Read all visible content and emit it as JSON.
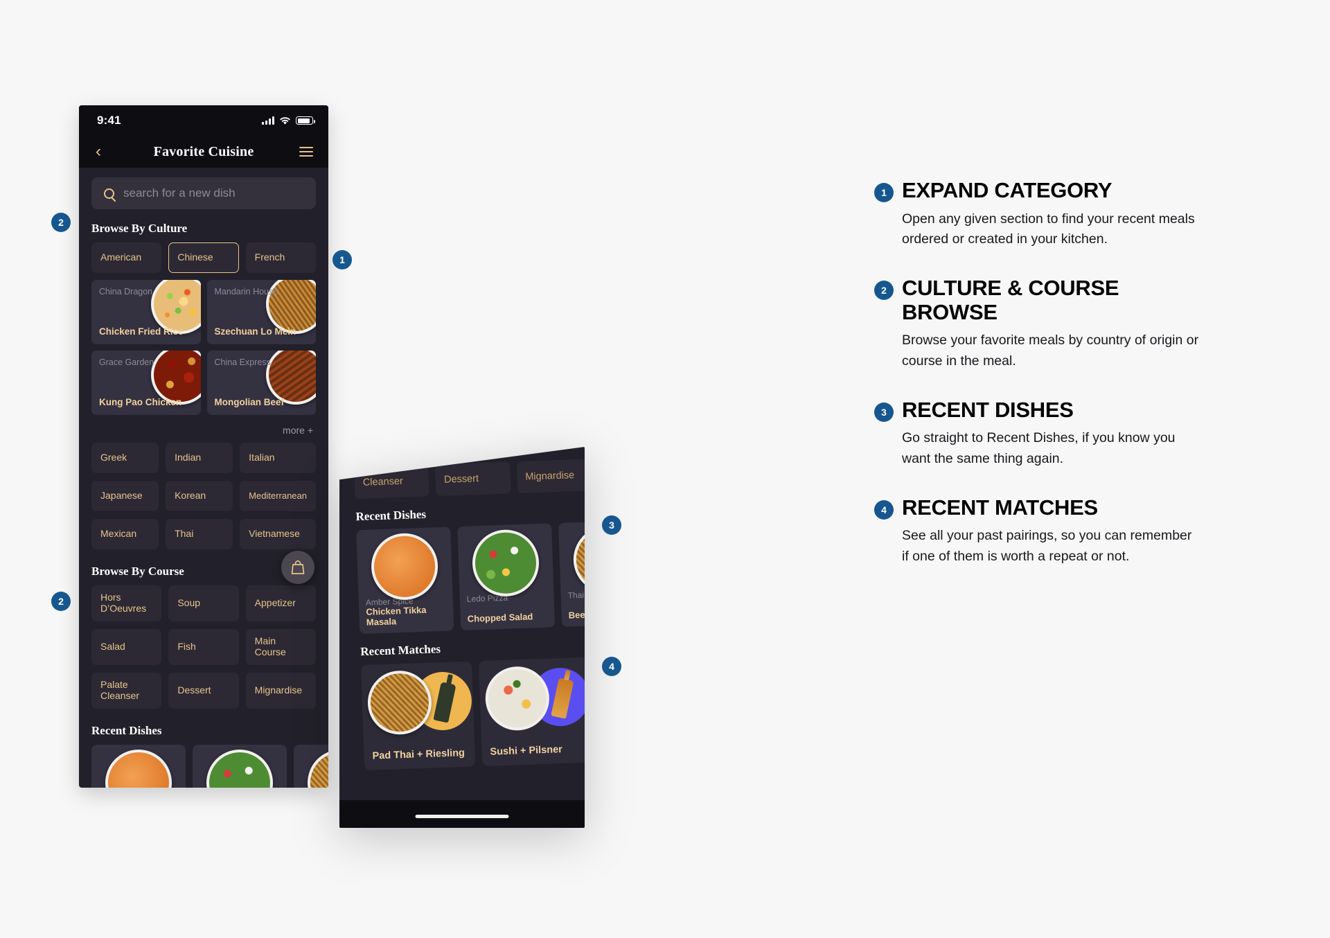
{
  "phone_main": {
    "status_bar": {
      "time": "9:41",
      "signal_icon": "cellular-bars-icon",
      "wifi_icon": "wifi-icon",
      "battery_icon": "battery-icon"
    },
    "nav": {
      "back_icon": "chevron-left-icon",
      "title": "Favorite Cuisine",
      "menu_icon": "hamburger-menu-icon"
    },
    "search": {
      "icon": "search-icon",
      "placeholder": "search for a new dish",
      "value": ""
    },
    "browse_by_culture": {
      "title": "Browse By Culture",
      "top_chips": [
        {
          "label": "American",
          "selected": false
        },
        {
          "label": "Chinese",
          "selected": true
        },
        {
          "label": "French",
          "selected": false
        }
      ],
      "dishes": [
        {
          "restaurant": "China Dragon",
          "name": "Chicken Fried Rice",
          "image": "fried-rice-photo"
        },
        {
          "restaurant": "Mandarin House",
          "name": "Szechuan Lo Mein",
          "image": "lo-mein-photo"
        },
        {
          "restaurant": "Grace Garden",
          "name": "Kung Pao Chicken",
          "image": "kung-pao-photo"
        },
        {
          "restaurant": "China Express",
          "name": "Mongolian Beef",
          "image": "mongolian-beef-photo"
        }
      ],
      "more_label": "more +",
      "chips": [
        "Greek",
        "Indian",
        "Italian",
        "Japanese",
        "Korean",
        "Mediterranean",
        "Mexican",
        "Thai",
        "Vietnamese"
      ]
    },
    "browse_by_course": {
      "title": "Browse By Course",
      "chips": [
        "Hors D’Oeuvres",
        "Soup",
        "Appetizer",
        "Salad",
        "Fish",
        "Main Course",
        "Palate Cleanser",
        "Dessert",
        "Mignardise"
      ]
    },
    "recent_dishes_title": "Recent Dishes",
    "bag_button_icon": "shopping-bag-icon"
  },
  "phone_detail": {
    "course_chips_visible": [
      "Cleanser",
      "Dessert",
      "Mignardise"
    ],
    "recent_dishes": {
      "title": "Recent Dishes",
      "items": [
        {
          "restaurant": "Amber Spice",
          "name": "Chicken Tikka Masala",
          "image": "tikka-masala-photo"
        },
        {
          "restaurant": "Ledo Pizza",
          "name": "Chopped Salad",
          "image": "chopped-salad-photo"
        },
        {
          "restaurant": "Thai at",
          "name": "Beef Pad Th",
          "image": "pad-thai-photo"
        }
      ]
    },
    "recent_matches": {
      "title": "Recent Matches",
      "items": [
        {
          "label": "Pad Thai + Riesling",
          "dish": "pad-thai-photo",
          "drink": "white-wine-bottle",
          "drink_bg": "#f0b650"
        },
        {
          "label": "Sushi + Pilsner",
          "dish": "sushi-platter-photo",
          "drink": "beer-bottle",
          "drink_bg": "#5b4ef0"
        },
        {
          "label": "",
          "dish": "kung-pao-photo",
          "drink": "",
          "drink_bg": "#2e2b38"
        }
      ]
    }
  },
  "callouts": {
    "markers": [
      "1",
      "2",
      "2",
      "3",
      "4"
    ],
    "notes": [
      {
        "num": "1",
        "title": "Expand Category",
        "body": "Open any given section to find your recent meals ordered or created in your kitchen."
      },
      {
        "num": "2",
        "title": "Culture & Course Browse",
        "body": "Browse your favorite meals by country of origin or course in the meal."
      },
      {
        "num": "3",
        "title": "Recent Dishes",
        "body": "Go straight to Recent Dishes, if you know you want the same thing again."
      },
      {
        "num": "4",
        "title": "Recent Matches",
        "body": "See all your past pairings, so you can remember if one of them is worth a repeat or not."
      }
    ]
  },
  "colors": {
    "badge_blue": "#17578f",
    "accent_gold": "#e8c48a",
    "panel_dark": "#22202a",
    "card_dark": "#2c2935",
    "page_bg": "#f7f7f7"
  }
}
